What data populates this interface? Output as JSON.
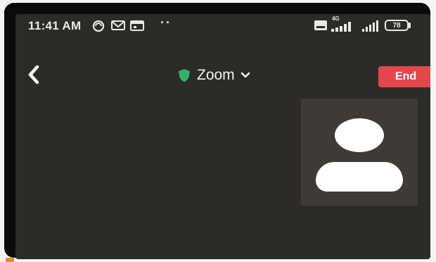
{
  "status_bar": {
    "time": "11:41 AM",
    "battery": "78",
    "network": "4G",
    "icons": [
      "sync-icon",
      "mail-icon",
      "calendar-icon",
      "more-dots-icon",
      "vowifi-icon",
      "signal-icon",
      "signal-icon",
      "battery-icon"
    ]
  },
  "header": {
    "title": "Zoom",
    "end_label": "End",
    "end_color": "#e5464b",
    "shield_color": "#2fb36b",
    "back_icon": "chevron-left-icon",
    "dropdown_icon": "chevron-down-icon"
  },
  "self_view": {
    "avatar_icon": "person-icon"
  }
}
